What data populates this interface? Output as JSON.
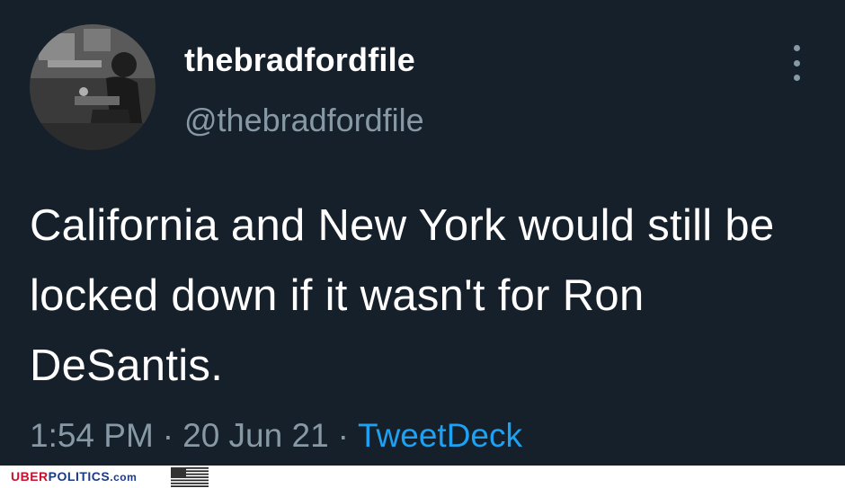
{
  "tweet": {
    "display_name": "thebradfordfile",
    "handle": "@thebradfordfile",
    "text": "California and New York would still be locked down if it wasn't for Ron DeSantis.",
    "time": "1:54 PM",
    "date": "20 Jun 21",
    "separator": "·",
    "source": "TweetDeck"
  },
  "watermark": {
    "uber": "UBER",
    "politics": "POLITICS",
    "com": ".com"
  },
  "icons": {
    "more": "more-vertical-icon",
    "avatar": "profile-photo",
    "flag": "us-flag-icon"
  },
  "colors": {
    "background": "#15202b",
    "primary_text": "#ffffff",
    "secondary_text": "#8899a6",
    "link": "#1da1f2"
  }
}
